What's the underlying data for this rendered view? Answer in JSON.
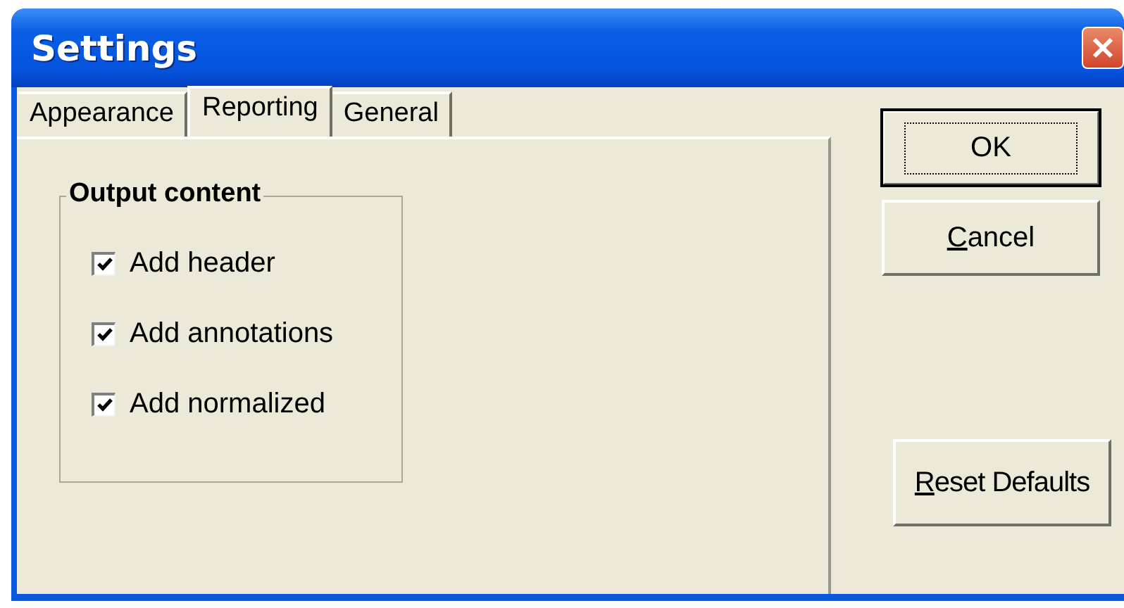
{
  "window": {
    "title": "Settings"
  },
  "tabs": [
    {
      "label": "Appearance",
      "selected": false
    },
    {
      "label": "Reporting",
      "selected": true
    },
    {
      "label": "General",
      "selected": false
    }
  ],
  "group": {
    "title": "Output content",
    "options": [
      {
        "label": "Add header",
        "checked": true
      },
      {
        "label": "Add annotations",
        "checked": true
      },
      {
        "label": "Add normalized",
        "checked": true
      }
    ]
  },
  "buttons": [
    {
      "label": "OK",
      "kind": "default"
    },
    {
      "label": "Cancel",
      "kind": "normal"
    },
    {
      "label": "Reset Defaults",
      "kind": "spaced"
    }
  ]
}
